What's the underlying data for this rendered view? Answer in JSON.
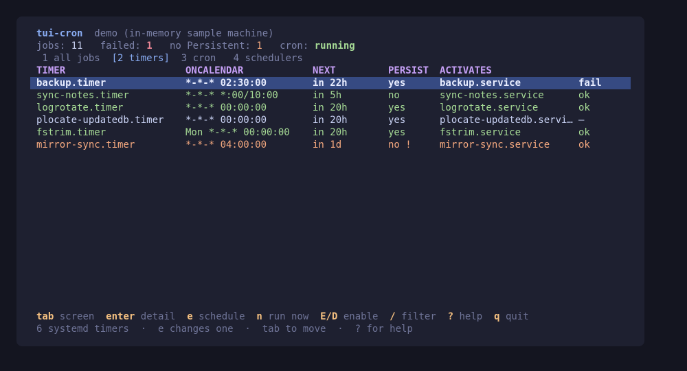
{
  "header": {
    "app_name": "tui-cron",
    "subtitle": "demo (in-memory sample machine)"
  },
  "status": {
    "jobs_label": "jobs:",
    "jobs_value": "11",
    "failed_label": "failed:",
    "failed_value": "1",
    "persistent_label": "no Persistent:",
    "persistent_value": "1",
    "cron_label": "cron:",
    "cron_value": "running"
  },
  "tabs": [
    {
      "label": "1 all jobs",
      "active": false
    },
    {
      "label": "[2 timers]",
      "active": true
    },
    {
      "label": "3 cron",
      "active": false
    },
    {
      "label": "4 schedulers",
      "active": false
    }
  ],
  "table": {
    "columns": [
      "TIMER",
      "ONCALENDAR",
      "NEXT",
      "PERSIST",
      "ACTIVATES",
      ""
    ],
    "rows": [
      {
        "timer": "backup.timer",
        "oncalendar": "*-*-* 02:30:00",
        "next": "in 22h",
        "persist": "yes",
        "activates": "backup.service",
        "status": "fail",
        "tone": "white",
        "selected": true
      },
      {
        "timer": "sync-notes.timer",
        "oncalendar": "*-*-* *:00/10:00",
        "next": "in 5h",
        "persist": "no",
        "activates": "sync-notes.service",
        "status": "ok",
        "tone": "green",
        "selected": false
      },
      {
        "timer": "logrotate.timer",
        "oncalendar": "*-*-* 00:00:00",
        "next": "in 20h",
        "persist": "yes",
        "activates": "logrotate.service",
        "status": "ok",
        "tone": "green",
        "selected": false
      },
      {
        "timer": "plocate-updatedb.timer",
        "oncalendar": "*-*-* 00:00:00",
        "next": "in 20h",
        "persist": "yes",
        "activates": "plocate-updatedb.servi…",
        "status": "—",
        "tone": "white",
        "selected": false
      },
      {
        "timer": "fstrim.timer",
        "oncalendar": "Mon *-*-* 00:00:00",
        "next": "in 20h",
        "persist": "yes",
        "activates": "fstrim.service",
        "status": "ok",
        "tone": "green",
        "selected": false
      },
      {
        "timer": "mirror-sync.timer",
        "oncalendar": "*-*-* 04:00:00",
        "next": "in 1d",
        "persist": "no !",
        "activates": "mirror-sync.service",
        "status": "ok",
        "tone": "orange",
        "selected": false
      }
    ]
  },
  "footer": {
    "keys": [
      {
        "key": "tab",
        "desc": "screen"
      },
      {
        "key": "enter",
        "desc": "detail"
      },
      {
        "key": "e",
        "desc": "schedule"
      },
      {
        "key": "n",
        "desc": "run now"
      },
      {
        "key": "E/D",
        "desc": "enable"
      },
      {
        "key": "/",
        "desc": "filter"
      },
      {
        "key": "?",
        "desc": "help"
      },
      {
        "key": "q",
        "desc": "quit"
      }
    ],
    "hint": "6 systemd timers  ·  e changes one  ·  tab to move  ·  ? for help"
  },
  "colors": {
    "background": "#1e2030",
    "selected_row": "#364a82",
    "header": "#c6a0f6",
    "green": "#a6da95",
    "orange": "#f5a97f",
    "red": "#ed8796",
    "key": "#f5c080"
  }
}
